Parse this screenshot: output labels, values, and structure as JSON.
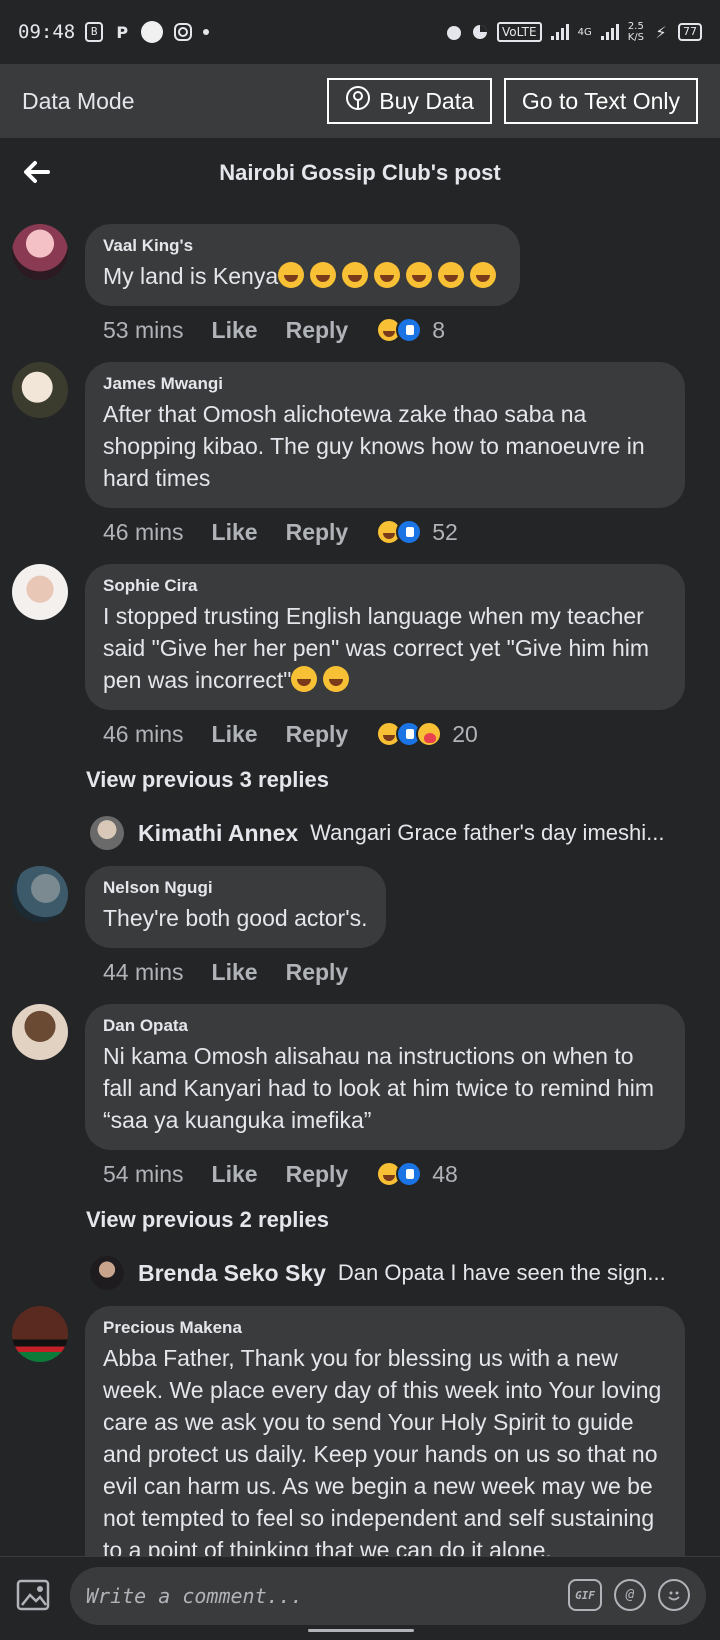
{
  "status_bar": {
    "time": "09:48",
    "network_label": "VoLTE",
    "network_type": "4G",
    "net_speed_value": "2.5",
    "net_speed_unit": "K/S",
    "battery": "77"
  },
  "data_mode": {
    "title": "Data Mode",
    "buy_data": "Buy Data",
    "text_only": "Go to Text Only"
  },
  "header": {
    "title": "Nairobi Gossip Club's post"
  },
  "comments": [
    {
      "author": "Vaal King's",
      "text": "My land is Kenya",
      "time": "53 mins",
      "like": "Like",
      "reply": "Reply",
      "reaction_count": "8"
    },
    {
      "author": "James Mwangi",
      "text": "After that Omosh alichotewa zake thao saba na shopping kibao. The guy knows how to manoeuvre in hard times",
      "time": "46 mins",
      "like": "Like",
      "reply": "Reply",
      "reaction_count": "52"
    },
    {
      "author": "Sophie Cira",
      "text": "I stopped trusting English language when my teacher said \"Give her her pen\" was correct yet \"Give him him pen was incorrect\"",
      "time": "46 mins",
      "like": "Like",
      "reply": "Reply",
      "reaction_count": "20"
    },
    {
      "author": "Nelson Ngugi",
      "text": "They're both good actor's.",
      "time": "44 mins",
      "like": "Like",
      "reply": "Reply"
    },
    {
      "author": "Dan Opata",
      "text": "Ni kama Omosh alisahau na instructions on when to fall and Kanyari had to look at him twice to remind him “saa ya kuanguka imefika”",
      "time": "54 mins",
      "like": "Like",
      "reply": "Reply",
      "reaction_count": "48"
    },
    {
      "author": "Precious Makena",
      "text": "Abba Father, Thank you for  blessing us with a new week. We place every day of this week into Your loving care as we ask you to send Your Holy Spirit to guide and protect us daily. Keep your hands on us so that no evil can harm us. As we begin a new week may we be not tempted to feel so independent and self sustaining to a point of thinking that we can do it alone."
    }
  ],
  "threads": [
    {
      "view_previous": "View previous 3 replies",
      "reply_name": "Kimathi Annex",
      "reply_text": "Wangari Grace father's day imeshi..."
    },
    {
      "view_previous": "View previous 2 replies",
      "reply_name": "Brenda Seko Sky",
      "reply_text": "Dan Opata I have seen the sign..."
    }
  ],
  "composer": {
    "placeholder": "Write a comment...",
    "gif_label": "GIF",
    "mention_label": "@"
  },
  "colors": {
    "background": "#242526",
    "bubble": "#3a3b3c",
    "data_mode_bar": "#3a3b3c",
    "like_blue": "#1b74e4",
    "haha_yellow": "#f7c035"
  }
}
